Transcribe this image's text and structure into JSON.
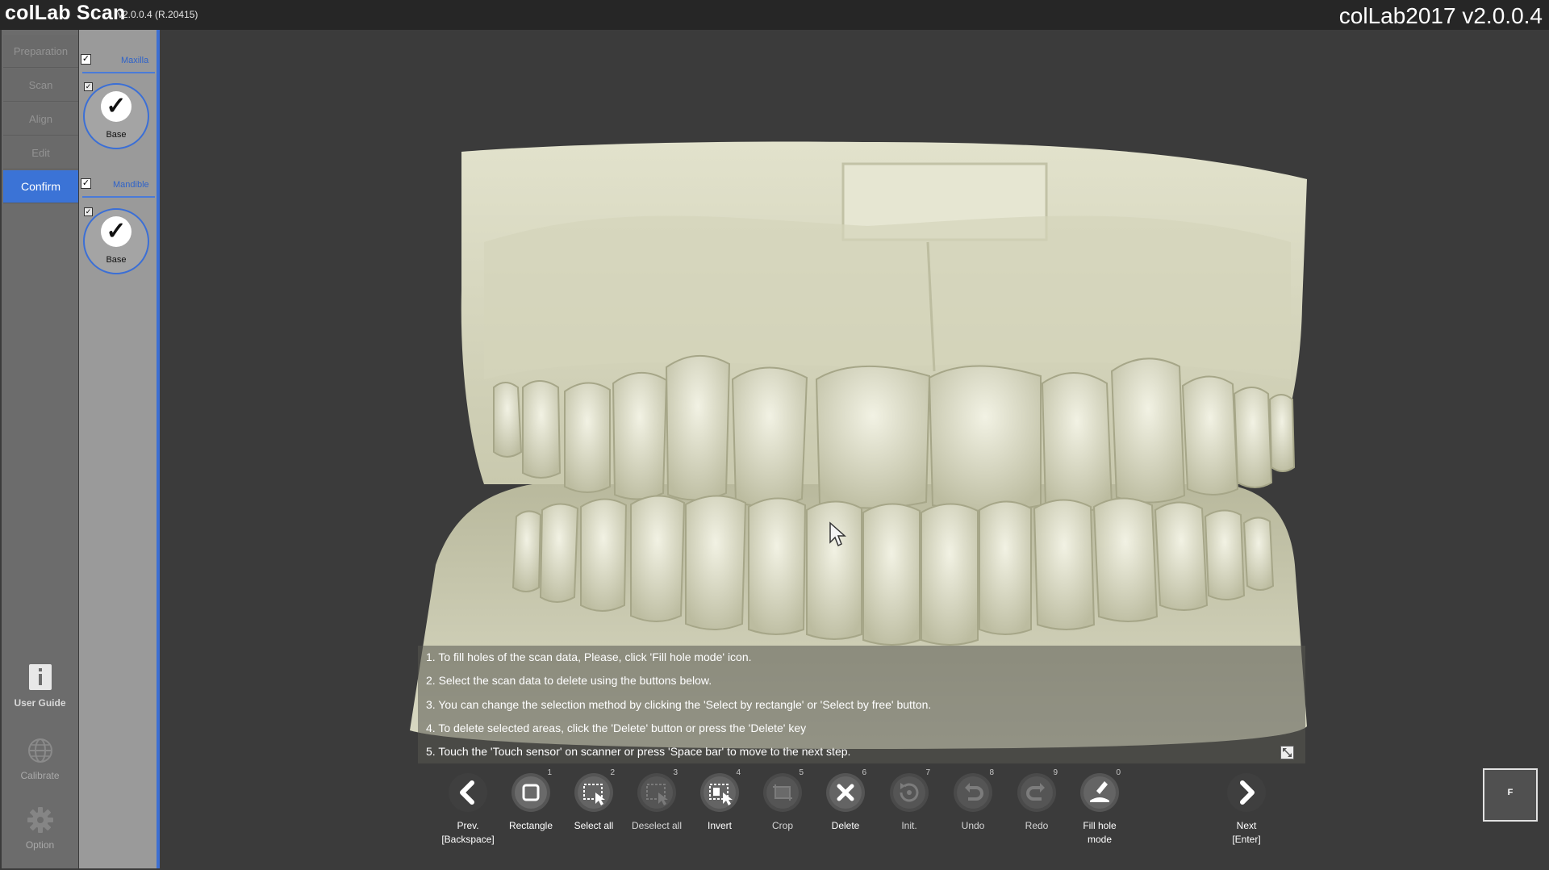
{
  "titlebar": {
    "app_name": "colLab Scan",
    "version": "v2.0.0.4 (R.20415)",
    "product_title": "colLab2017 v2.0.0.4"
  },
  "steps": [
    {
      "label": "Preparation",
      "active": false
    },
    {
      "label": "Scan",
      "active": false
    },
    {
      "label": "Align",
      "active": false
    },
    {
      "label": "Edit",
      "active": false
    },
    {
      "label": "Confirm",
      "active": true
    }
  ],
  "side_utils": {
    "user_guide": "User Guide",
    "calibrate": "Calibrate",
    "option": "Option"
  },
  "jaw_panel": {
    "maxilla": {
      "label": "Maxilla",
      "checked": true,
      "base_label": "Base",
      "base_tick": "✓"
    },
    "mandible": {
      "label": "Mandible",
      "checked": true,
      "base_label": "Base",
      "base_tick": "✓"
    }
  },
  "instructions": [
    "1. To fill holes of the scan data, Please, click 'Fill hole mode' icon.",
    "2. Select the scan data to delete using the buttons below.",
    "3. You can change the selection method by clicking the 'Select by rectangle' or 'Select by free' button.",
    "4. To delete selected areas, click the 'Delete' button or press the 'Delete' key",
    "5. Touch the 'Touch sensor' on scanner or press 'Space bar' to move to the next step."
  ],
  "toolbar": {
    "prev": {
      "label1": "Prev.",
      "label2": "[Backspace]"
    },
    "tools": [
      {
        "key": "rectangle",
        "label": "Rectangle",
        "num": "1"
      },
      {
        "key": "select-all",
        "label": "Select all",
        "num": "2"
      },
      {
        "key": "deselect-all",
        "label": "Deselect all",
        "num": "3"
      },
      {
        "key": "invert",
        "label": "Invert",
        "num": "4"
      },
      {
        "key": "crop",
        "label": "Crop",
        "num": "5"
      },
      {
        "key": "delete",
        "label": "Delete",
        "num": "6"
      },
      {
        "key": "init",
        "label": "Init.",
        "num": "7"
      },
      {
        "key": "undo",
        "label": "Undo",
        "num": "8"
      },
      {
        "key": "redo",
        "label": "Redo",
        "num": "9"
      },
      {
        "key": "fill-hole",
        "label1": "Fill hole",
        "label2": "mode",
        "num": "0"
      }
    ],
    "next": {
      "label1": "Next",
      "label2": "[Enter]"
    }
  },
  "view_toggle": "F",
  "icons": {
    "prev": "chevron-left-icon",
    "next": "chevron-right-icon",
    "check": "check-icon",
    "user_guide": "info-icon",
    "calibrate": "globe-icon",
    "option": "gear-icon",
    "expand": "expand-icon"
  },
  "colors": {
    "accent_blue": "#3b73d6",
    "titlebar": "#262626",
    "background": "#3b3b3b",
    "model": "#d9d9c3"
  }
}
